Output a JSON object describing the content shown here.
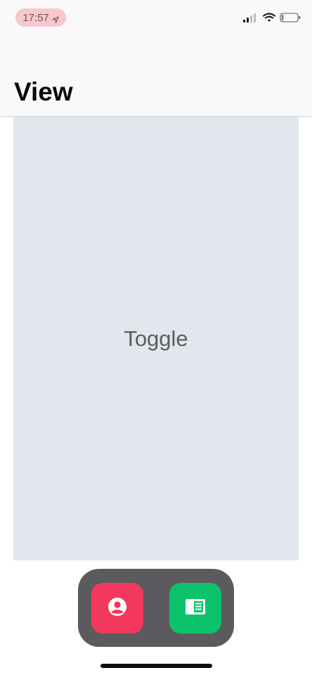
{
  "status_bar": {
    "time": "17:57",
    "location_icon": "location-arrow-icon",
    "signal_icon": "cellular-signal-icon",
    "wifi_icon": "wifi-icon",
    "battery_icon": "battery-icon"
  },
  "header": {
    "title": "View"
  },
  "main": {
    "toggle_label": "Toggle"
  },
  "dock": {
    "items": [
      {
        "icon": "user-circle-icon",
        "color": "#f3385d"
      },
      {
        "icon": "reader-icon",
        "color": "#0dc26b"
      }
    ]
  },
  "colors": {
    "time_pill": "#f6c8cb",
    "header_bg": "#f9f8fb",
    "toggle_bg": "#e2e6ed",
    "dock_bg": "#5b5b5f"
  }
}
